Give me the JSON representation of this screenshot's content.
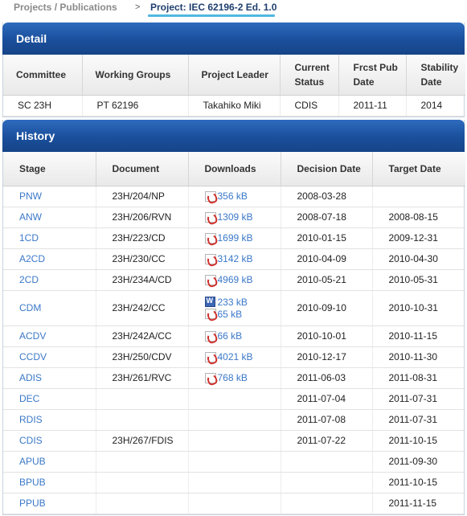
{
  "breadcrumb": {
    "parent": "Projects / Publications",
    "separator": ">",
    "current": "Project: IEC 62196-2 Ed. 1.0"
  },
  "detail": {
    "title": "Detail",
    "headers": {
      "committee": "Committee",
      "working_groups": "Working Groups",
      "project_leader": "Project Leader",
      "status_line1": "Current",
      "status_line2": "Status",
      "frcst_line1": "Frcst Pub",
      "frcst_line2": "Date",
      "stability_line1": "Stability",
      "stability_line2": "Date"
    },
    "row": {
      "committee": "SC 23H",
      "working_groups": "PT 62196",
      "project_leader": "Takahiko Miki",
      "status": "CDIS",
      "frcst": "2011-11",
      "stability": "2014"
    }
  },
  "history": {
    "title": "History",
    "headers": {
      "stage": "Stage",
      "document": "Document",
      "downloads": "Downloads",
      "decision": "Decision Date",
      "target": "Target Date"
    },
    "rows": [
      {
        "stage": "PNW",
        "document": "23H/204/NP",
        "downloads": [
          {
            "type": "pdf-icon",
            "size": "356 kB"
          }
        ],
        "decision": "2008-03-28",
        "target": ""
      },
      {
        "stage": "ANW",
        "document": "23H/206/RVN",
        "downloads": [
          {
            "type": "pdf-icon",
            "size": "1309 kB"
          }
        ],
        "decision": "2008-07-18",
        "target": "2008-08-15"
      },
      {
        "stage": "1CD",
        "document": "23H/223/CD",
        "downloads": [
          {
            "type": "pdf-icon",
            "size": "1699 kB"
          }
        ],
        "decision": "2010-01-15",
        "target": "2009-12-31"
      },
      {
        "stage": "A2CD",
        "document": "23H/230/CC",
        "downloads": [
          {
            "type": "pdf-icon",
            "size": "3142 kB"
          }
        ],
        "decision": "2010-04-09",
        "target": "2010-04-30"
      },
      {
        "stage": "2CD",
        "document": "23H/234A/CD",
        "downloads": [
          {
            "type": "pdf-icon",
            "size": "4969 kB"
          }
        ],
        "decision": "2010-05-21",
        "target": "2010-05-31"
      },
      {
        "stage": "CDM",
        "document": "23H/242/CC",
        "downloads": [
          {
            "type": "word-doc-icon",
            "size": "233 kB"
          },
          {
            "type": "pdf-icon",
            "size": "65 kB"
          }
        ],
        "decision": "2010-09-10",
        "target": "2010-10-31"
      },
      {
        "stage": "ACDV",
        "document": "23H/242A/CC",
        "downloads": [
          {
            "type": "pdf-icon",
            "size": "66 kB"
          }
        ],
        "decision": "2010-10-01",
        "target": "2010-11-15"
      },
      {
        "stage": "CCDV",
        "document": "23H/250/CDV",
        "downloads": [
          {
            "type": "pdf-icon",
            "size": "4021 kB"
          }
        ],
        "decision": "2010-12-17",
        "target": "2010-11-30"
      },
      {
        "stage": "ADIS",
        "document": "23H/261/RVC",
        "downloads": [
          {
            "type": "pdf-icon",
            "size": "768 kB"
          }
        ],
        "decision": "2011-06-03",
        "target": "2011-08-31"
      },
      {
        "stage": "DEC",
        "document": "",
        "downloads": [],
        "decision": "2011-07-04",
        "target": "2011-07-31"
      },
      {
        "stage": "RDIS",
        "document": "",
        "downloads": [],
        "decision": "2011-07-08",
        "target": "2011-07-31"
      },
      {
        "stage": "CDIS",
        "document": "23H/267/FDIS",
        "downloads": [],
        "decision": "2011-07-22",
        "target": "2011-10-15"
      },
      {
        "stage": "APUB",
        "document": "",
        "downloads": [],
        "decision": "",
        "target": "2011-09-30"
      },
      {
        "stage": "BPUB",
        "document": "",
        "downloads": [],
        "decision": "",
        "target": "2011-10-15"
      },
      {
        "stage": "PPUB",
        "document": "",
        "downloads": [],
        "decision": "",
        "target": "2011-11-15"
      }
    ]
  },
  "colors": {
    "panel_header": "#1a4f9c",
    "link": "#3a78c8",
    "breadcrumb_underline": "#4fb8e0"
  }
}
